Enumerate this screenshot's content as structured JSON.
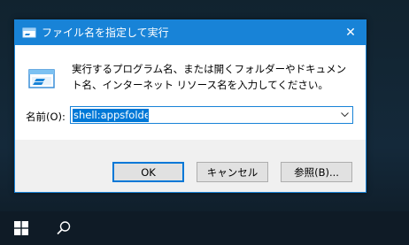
{
  "dialog": {
    "title": "ファイル名を指定して実行",
    "close_glyph": "✕",
    "instruction": "実行するプログラム名、または開くフォルダーやドキュメント名、インターネット リソース名を入力してください。",
    "open_label": "名前(O):",
    "open_value": "shell:appsfolder",
    "buttons": {
      "ok": "OK",
      "cancel": "キャンセル",
      "browse": "参照(B)..."
    }
  },
  "taskbar": {
    "start_icon": "windows-logo-icon",
    "search_icon": "search-icon"
  },
  "colors": {
    "accent": "#1883d7",
    "selection": "#0078d7",
    "footer": "#f0f0f0",
    "taskbar": "#0f1b26"
  }
}
